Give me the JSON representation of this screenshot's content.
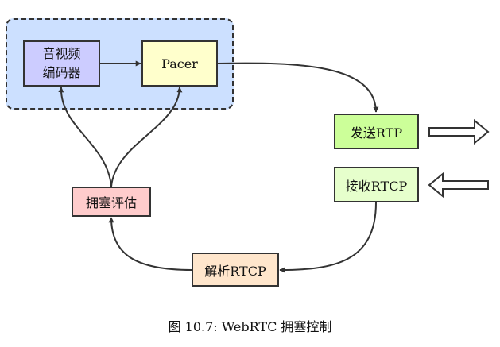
{
  "diagram": {
    "colors": {
      "group_fill": "#cce0ff",
      "codec_fill": "#ccccff",
      "pacer_fill": "#ffffcc",
      "send_fill": "#ccff99",
      "recv_fill": "#e6ffcc",
      "cc_fill": "#ffcccc",
      "parse_fill": "#ffe6cc",
      "stroke": "#333333"
    },
    "nodes": {
      "codec": {
        "line1": "音视频",
        "line2": "编码器"
      },
      "pacer": {
        "label": "Pacer"
      },
      "send_rtp": {
        "label": "发送RTP"
      },
      "recv_rtcp": {
        "label": "接收RTCP"
      },
      "congestion_estimate": {
        "label": "拥塞评估"
      },
      "parse_rtcp": {
        "label": "解析RTCP"
      }
    },
    "edges": [
      {
        "from": "codec",
        "to": "pacer"
      },
      {
        "from": "pacer",
        "to": "send_rtp"
      },
      {
        "from": "recv_rtcp",
        "to": "parse_rtcp"
      },
      {
        "from": "parse_rtcp",
        "to": "congestion_estimate"
      },
      {
        "from": "congestion_estimate",
        "to": "codec"
      },
      {
        "from": "congestion_estimate",
        "to": "pacer"
      }
    ],
    "external_arrows": [
      {
        "direction": "outgoing",
        "node": "send_rtp"
      },
      {
        "direction": "incoming",
        "node": "recv_rtcp"
      }
    ]
  },
  "caption": "图 10.7: WebRTC 拥塞控制"
}
